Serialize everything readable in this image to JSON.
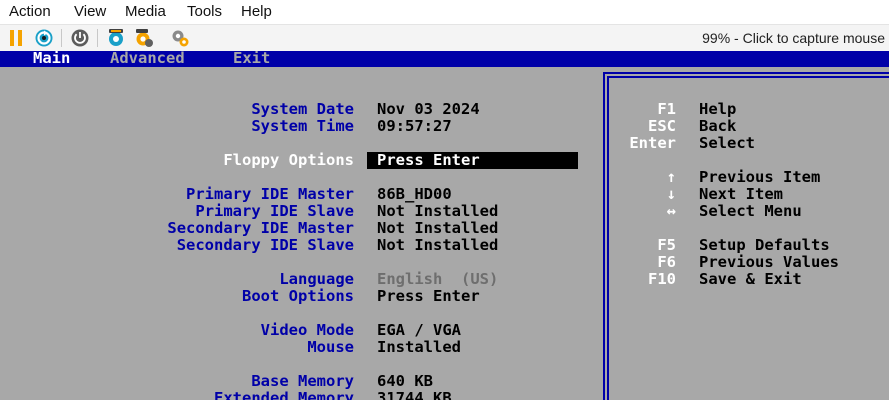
{
  "menubar": {
    "items": [
      "Action",
      "View",
      "Media",
      "Tools",
      "Help"
    ]
  },
  "toolbar": {
    "capture_text": "99% - Click to capture mouse",
    "icons": [
      "pause-icon",
      "reset-icon",
      "power-icon",
      "settings-icon",
      "settings-alt-icon",
      "settings-gear-icon"
    ],
    "colors": {
      "pause": "#f5a300",
      "reset": "#1aa0c8",
      "power": "#606060"
    }
  },
  "bios": {
    "colors": {
      "background": "#a8a8a8",
      "menu": "#0000a8",
      "label": "#0000a8"
    },
    "menu": [
      "Main",
      "Advanced",
      "Exit"
    ],
    "fields": [
      {
        "label": "System Date",
        "value": "Nov 03 2024"
      },
      {
        "label": "System Time",
        "value": "09:57:27"
      },
      {
        "label": "Floppy Options",
        "value": "Press Enter"
      },
      {
        "label": "Primary IDE Master",
        "value": "86B_HD00"
      },
      {
        "label": "Primary IDE Slave",
        "value": "Not Installed"
      },
      {
        "label": "Secondary IDE Master",
        "value": "Not Installed"
      },
      {
        "label": "Secondary IDE Slave",
        "value": "Not Installed"
      },
      {
        "label": "Language",
        "value": "English  (US)"
      },
      {
        "label": "Boot Options",
        "value": "Press Enter"
      },
      {
        "label": "Video Mode",
        "value": "EGA / VGA"
      },
      {
        "label": "Mouse",
        "value": "Installed"
      },
      {
        "label": "Base Memory",
        "value": "640 KB"
      },
      {
        "label": "Extended Memory",
        "value": "31744 KB"
      }
    ],
    "help": [
      {
        "key": "F1",
        "desc": "Help"
      },
      {
        "key": "ESC",
        "desc": "Back"
      },
      {
        "key": "Enter",
        "desc": "Select"
      },
      {
        "key": "↑",
        "desc": "Previous Item"
      },
      {
        "key": "↓",
        "desc": "Next Item"
      },
      {
        "key": "↔",
        "desc": "Select Menu"
      },
      {
        "key": "F5",
        "desc": "Setup Defaults"
      },
      {
        "key": "F6",
        "desc": "Previous Values"
      },
      {
        "key": "F10",
        "desc": "Save & Exit"
      }
    ]
  }
}
